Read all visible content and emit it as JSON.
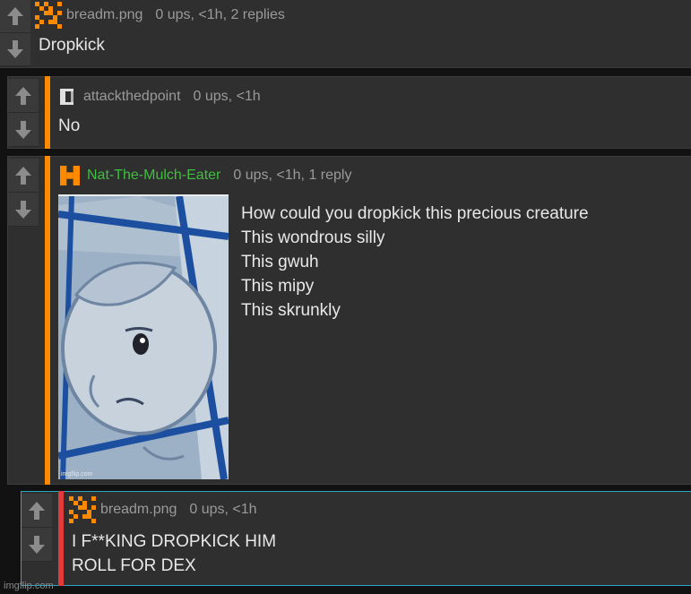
{
  "comments": [
    {
      "username": "breadm.png",
      "meta": "0 ups, <1h, 2 replies",
      "text": "Dropkick",
      "avatar": "pixel-checker-orange"
    },
    {
      "username": "attackthedpoint",
      "meta": "0 ups, <1h",
      "text": "No",
      "avatar": "pixel-bracket-gray"
    },
    {
      "username": "Nat-The-Mulch-Eater",
      "meta": "0 ups, <1h, 1 reply",
      "text_lines": [
        "How could you dropkick this precious creature",
        "This wondrous silly",
        "This gwuh",
        "This mipy",
        "This skrunkly"
      ],
      "avatar": "pixel-H-orange",
      "image_watermark": "imgflip.com"
    },
    {
      "username": "breadm.png",
      "meta": "0 ups, <1h",
      "text_lines": [
        "I F**KING DROPKICK HIM",
        "ROLL FOR DEX"
      ],
      "avatar": "pixel-checker-orange"
    }
  ],
  "watermark": "imgflip.com",
  "colors": {
    "accent_orange": "#ff8a00",
    "accent_red": "#e23b3b",
    "reply_border_cyan": "#2aa7c4",
    "username_green": "#3fbf3f",
    "background": "#121212",
    "panel": "#2f2f2f"
  },
  "icons": {
    "upvote": "up-arrow-icon",
    "downvote": "down-arrow-icon"
  }
}
